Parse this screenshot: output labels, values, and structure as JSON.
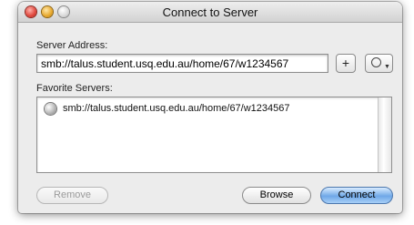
{
  "window": {
    "title": "Connect to Server"
  },
  "server_address": {
    "label": "Server Address:",
    "value": "smb://talus.student.usq.edu.au/home/67/w1234567"
  },
  "buttons": {
    "add": "+",
    "recent_icon": "clock-icon",
    "remove": "Remove",
    "browse": "Browse",
    "connect": "Connect"
  },
  "favorites": {
    "label": "Favorite Servers:",
    "items": [
      {
        "text": "smb://talus.student.usq.edu.au/home/67/w1234567",
        "icon": "server-globe-icon"
      }
    ]
  },
  "colors": {
    "default_button": "#6fa8e7",
    "window_bg": "#ececec"
  }
}
